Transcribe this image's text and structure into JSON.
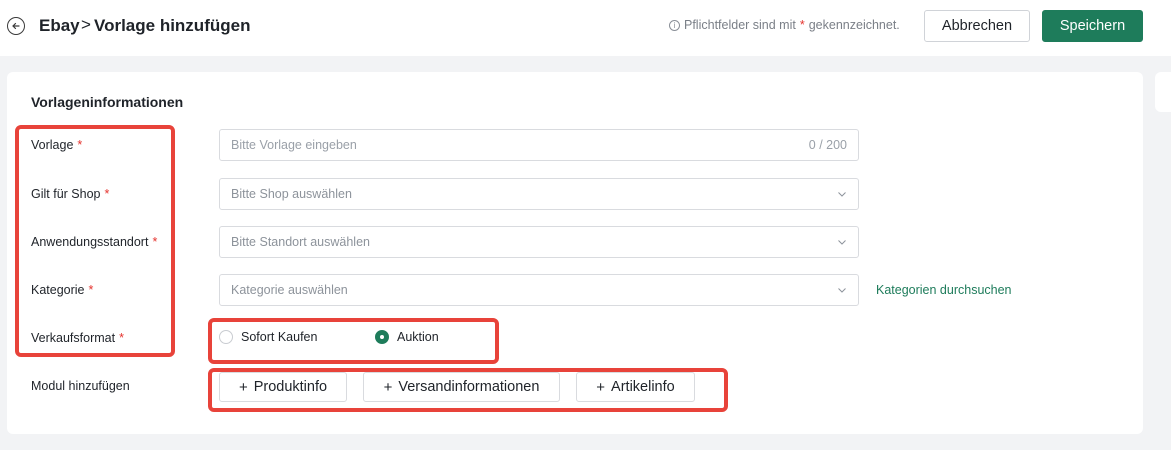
{
  "header": {
    "breadcrumb_root": "Ebay",
    "breadcrumb_sep": ">",
    "title": "Vorlage hinzufügen",
    "hint_prefix": "Pflichtfelder sind mit",
    "hint_star": "*",
    "hint_suffix": "gekennzeichnet.",
    "cancel_label": "Abbrechen",
    "save_label": "Speichern"
  },
  "section": {
    "title": "Vorlageninformationen"
  },
  "form": {
    "vorlage": {
      "label": "Vorlage",
      "star": "*",
      "placeholder": "Bitte Vorlage eingeben",
      "value": "",
      "counter": "0 / 200"
    },
    "shop": {
      "label": "Gilt für Shop",
      "star": "*",
      "placeholder": "Bitte Shop auswählen"
    },
    "standort": {
      "label": "Anwendungsstandort",
      "star": "*",
      "placeholder": "Bitte Standort auswählen"
    },
    "kategorie": {
      "label": "Kategorie",
      "star": "*",
      "placeholder": "Kategorie auswählen",
      "link": "Kategorien durchsuchen"
    },
    "verkaufsformat": {
      "label": "Verkaufsformat",
      "star": "*",
      "options": [
        "Sofort Kaufen",
        "Auktion"
      ],
      "selected": "Auktion"
    },
    "modul": {
      "label": "Modul hinzufügen",
      "buttons": [
        "Produktinfo",
        "Versandinformationen",
        "Artikelinfo"
      ]
    }
  },
  "colors": {
    "accent": "#1e7c5b",
    "required": "#e5322d",
    "highlight": "#e8433a"
  }
}
